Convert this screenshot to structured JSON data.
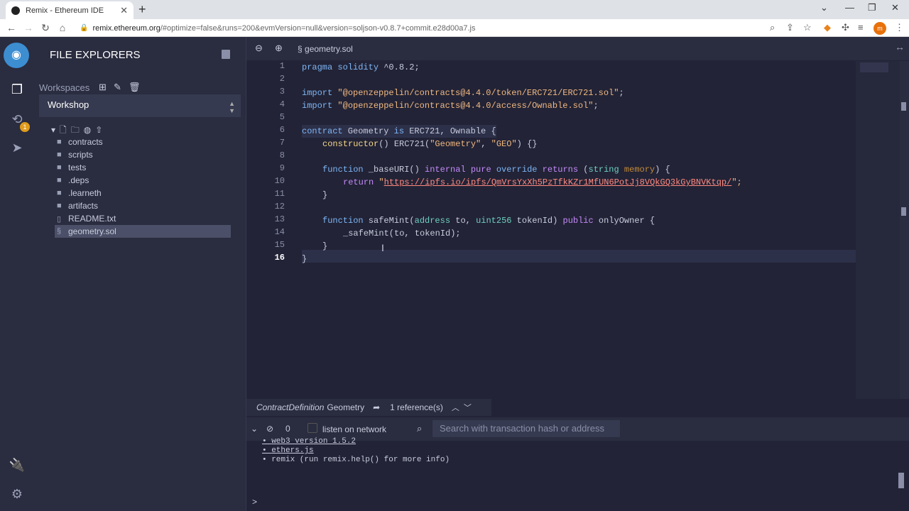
{
  "browser": {
    "tab_title": "Remix - Ethereum IDE",
    "url_host": "remix.ethereum.org",
    "url_path": "/#optimize=false&runs=200&evmVersion=null&version=soljson-v0.8.7+commit.e28d00a7.js",
    "profile_initial": "m"
  },
  "icons": {
    "logo": "remix-logo-icon",
    "file_explorer": "file-explorer-icon",
    "compiler": "solidity-compiler-icon",
    "compiler_badge": "1",
    "deploy": "deploy-run-icon",
    "plugin": "plugin-manager-icon",
    "settings": "settings-gear-icon"
  },
  "sidebar": {
    "title": "FILE EXPLORERS",
    "workspaces_label": "Workspaces",
    "workspace_selected": "Workshop",
    "files": [
      {
        "name": "contracts",
        "type": "folder"
      },
      {
        "name": "scripts",
        "type": "folder"
      },
      {
        "name": "tests",
        "type": "folder"
      },
      {
        "name": ".deps",
        "type": "folder"
      },
      {
        "name": ".learneth",
        "type": "folder"
      },
      {
        "name": "artifacts",
        "type": "folder"
      },
      {
        "name": "README.txt",
        "type": "file"
      },
      {
        "name": "geometry.sol",
        "type": "sol",
        "selected": true
      }
    ]
  },
  "editor": {
    "tab": "geometry.sol",
    "line_numbers": [
      "1",
      "2",
      "3",
      "4",
      "5",
      "6",
      "7",
      "8",
      "9",
      "10",
      "11",
      "12",
      "13",
      "14",
      "15",
      "16"
    ],
    "current_line": "16"
  },
  "code": {
    "l1_kw": "pragma solidity",
    "l1_rest": " ^0.8.2;",
    "l3_kw": "import",
    "l3_str": "\"@openzeppelin/contracts@4.4.0/token/ERC721/ERC721.sol\"",
    "l3_end": ";",
    "l4_kw": "import",
    "l4_str": "\"@openzeppelin/contracts@4.4.0/access/Ownable.sol\"",
    "l4_end": ";",
    "l6_kw": "contract",
    "l6_a": " Geometry ",
    "l6_kw2": "is",
    "l6_b": " ERC721, Ownable {",
    "l7_fn": "constructor",
    "l7_a": "() ERC721(",
    "l7_s1": "\"Geometry\"",
    "l7_b": ", ",
    "l7_s2": "\"GEO\"",
    "l7_c": ") {}",
    "l9_kw": "function",
    "l9_a": " _baseURI() ",
    "l9_m1": "internal pure",
    "l9_m2": " override ",
    "l9_m3": "returns",
    "l9_b": " (",
    "l9_t": "string",
    "l9_mem": " memory",
    "l9_c": ") {",
    "l10_kw": "return",
    "l10_q1": " \"",
    "l10_url": "https://ipfs.io/ipfs/QmVrsYxXh5PzTfkKZr1MfUN6PotJj8VQkGQ3kGyBNVKtqp/",
    "l10_q2": "\";",
    "l11": "}",
    "l13_kw": "function",
    "l13_a": " safeMint(",
    "l13_t1": "address",
    "l13_b": " to, ",
    "l13_t2": "uint256",
    "l13_c": " tokenId) ",
    "l13_m": "public",
    "l13_d": " onlyOwner {",
    "l14": "_safeMint(to, tokenId);",
    "l15": "}",
    "l16": "}"
  },
  "refbar": {
    "kind": "ContractDefinition",
    "name": "Geometry",
    "count": "1 reference(s)"
  },
  "terminal": {
    "tx_count": "0",
    "listen_label": "listen on network",
    "search_placeholder": "Search with transaction hash or address",
    "lines": [
      "web3 version 1.5.2",
      "ethers.js",
      "remix (run remix.help() for more info)"
    ],
    "prompt": ">"
  }
}
